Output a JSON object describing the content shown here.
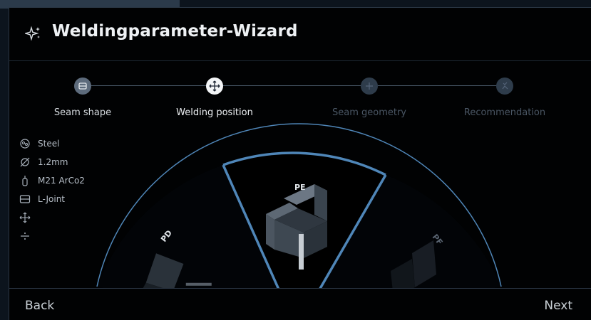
{
  "header": {
    "title": "Weldingparameter-Wizard",
    "icon": "sparkle-icon"
  },
  "stepper": {
    "steps": [
      {
        "label": "Seam shape",
        "state": "done",
        "icon": "seam-shape-icon"
      },
      {
        "label": "Welding position",
        "state": "active",
        "icon": "move-arrows-icon"
      },
      {
        "label": "Seam geometry",
        "state": "pending",
        "icon": "seam-geometry-icon"
      },
      {
        "label": "Recommendation",
        "state": "pending",
        "icon": "recommendation-icon"
      }
    ]
  },
  "params": [
    {
      "icon": "material-icon",
      "text": "Steel"
    },
    {
      "icon": "diameter-icon",
      "text": "1.2mm"
    },
    {
      "icon": "gas-bottle-icon",
      "text": "M21 ArCo2"
    },
    {
      "icon": "joint-icon",
      "text": "L-Joint"
    },
    {
      "icon": "move-arrows-icon",
      "text": ""
    },
    {
      "icon": "divide-icon",
      "text": ""
    }
  ],
  "positions": {
    "left": "PD",
    "center": "PE",
    "right": "PF",
    "selected": "PE"
  },
  "footer": {
    "back_label": "Back",
    "next_label": "Next"
  },
  "colors": {
    "accent": "#4f86b8",
    "background": "#010203",
    "panel": "#0c141d"
  }
}
